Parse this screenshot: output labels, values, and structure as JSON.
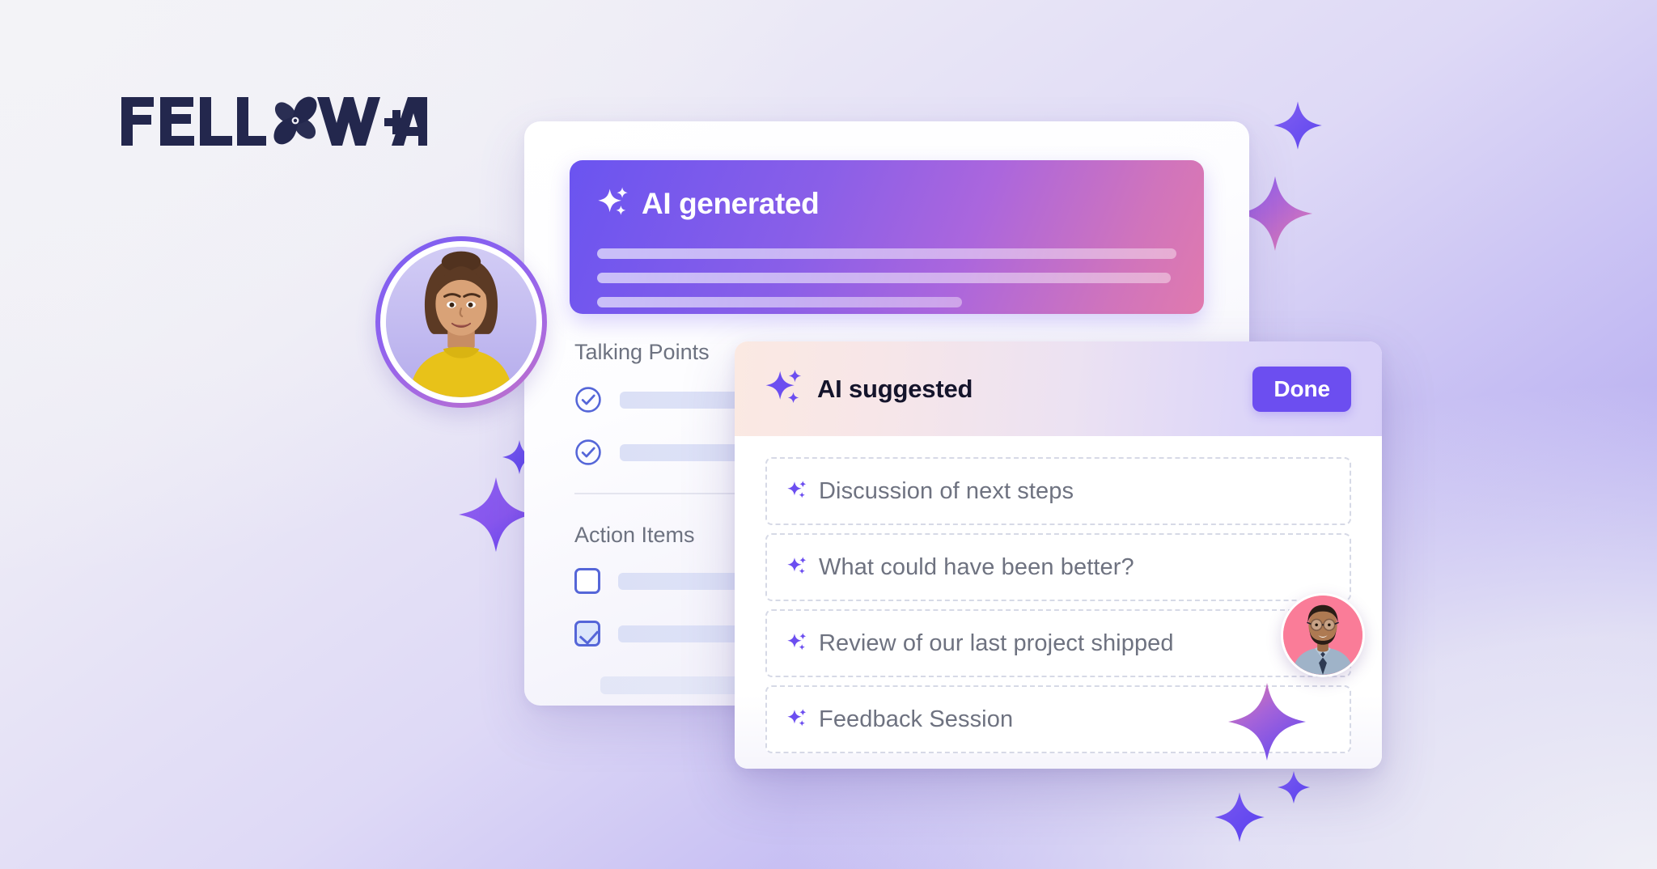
{
  "brand": {
    "logo_text_left": "FELL",
    "logo_text_right": "W",
    "logo_plus": "+",
    "logo_ai": "AI",
    "logo_full": "FELLOW + AI",
    "logo_mark_icon": "fellow-link-icon",
    "logo_color": "#23274d"
  },
  "colors": {
    "accent_purple": "#6c4ef0",
    "banner_gradient_start": "#6a54f0",
    "banner_gradient_end": "#e07aae",
    "suggest_header_start": "#fbe9e2",
    "suggest_header_end": "#d7cff8",
    "checkbox_blue": "#5566d8",
    "muted_text": "#6e7280",
    "dark_text": "#14142b",
    "background_start": "#f3f3f7",
    "background_end": "#a49cee"
  },
  "doc_card": {
    "ai_banner": {
      "icon": "sparkle-icon",
      "title": "AI generated",
      "placeholder_lines": [
        100,
        99,
        63
      ]
    },
    "sections": [
      {
        "title": "Talking Points",
        "items": [
          {
            "checkbox": "circle-checked",
            "checked": true
          },
          {
            "checkbox": "circle-checked",
            "checked": true
          }
        ]
      },
      {
        "title": "Action Items",
        "items": [
          {
            "checkbox": "square-unchecked",
            "checked": false
          },
          {
            "checkbox": "square-checked",
            "checked": true
          }
        ]
      }
    ]
  },
  "suggest_card": {
    "header": {
      "icon": "sparkle-icon",
      "title": "AI suggested",
      "done_label": "Done"
    },
    "items": [
      {
        "icon": "sparkle-icon",
        "label": "Discussion of next steps"
      },
      {
        "icon": "sparkle-icon",
        "label": "What could have been better?"
      },
      {
        "icon": "sparkle-icon",
        "label": "Review of our last project shipped"
      },
      {
        "icon": "sparkle-icon",
        "label": "Feedback Session"
      }
    ]
  },
  "avatars": [
    {
      "name": "avatar-woman-yellow-top",
      "ring": "purple-gradient"
    },
    {
      "name": "avatar-man-glasses",
      "ring": "pink"
    }
  ],
  "decorations": {
    "sparkles": 10
  }
}
